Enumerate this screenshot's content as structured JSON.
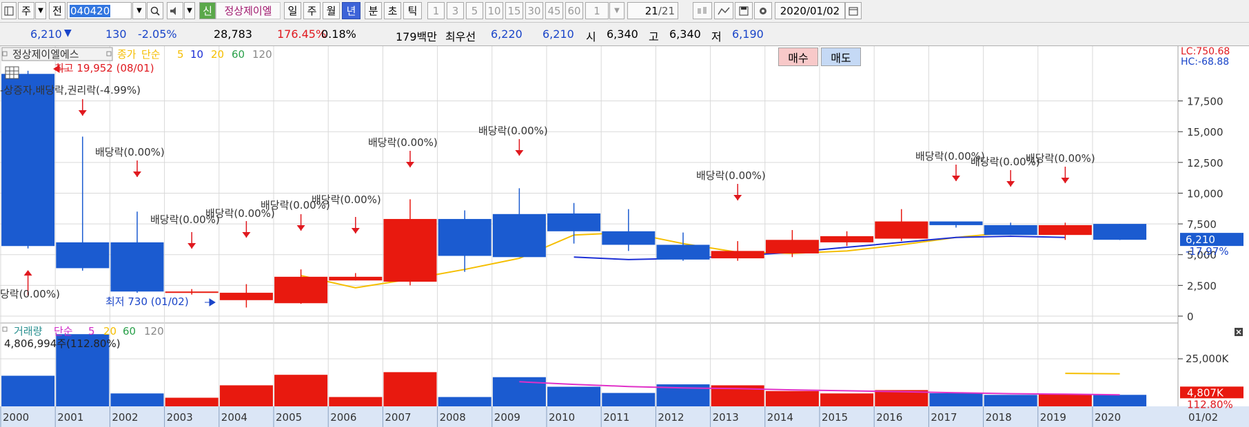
{
  "toolbar": {
    "period_select": "주",
    "prev_label": "전",
    "stock_code": "040420",
    "new_badge": "신",
    "stock_name": "정상제이엘",
    "tf_day": "일",
    "tf_week": "주",
    "tf_month": "월",
    "tf_year": "년",
    "tf_minute": "분",
    "tf_second": "초",
    "tf_tick": "틱",
    "intervals": [
      "1",
      "3",
      "5",
      "10",
      "15",
      "30",
      "45",
      "60"
    ],
    "interval_input": "1",
    "count_value": "21",
    "count_total": "/21",
    "date_value": "2020/01/02"
  },
  "quote": {
    "price": "6,210",
    "change_arrow": "▼",
    "change": "130",
    "change_pct": "-2.05%",
    "volume": "28,783",
    "volume_ratio": "176.45%",
    "turnover": "0.18%",
    "trade_value": "179백만",
    "best_label": "최우선",
    "best_ask": "6,220",
    "best_bid": "6,210",
    "open_label": "시",
    "open": "6,340",
    "high_label": "고",
    "high": "6,340",
    "low_label": "저",
    "low": "6,190",
    "buy_label": "매수",
    "sell_label": "매도"
  },
  "colors": {
    "up": "#e8190f",
    "down": "#1b5bd0",
    "ma5": "#f5be00",
    "ma10": "#1c2fd6",
    "vol_ma": "#e030c8",
    "grid": "#d9d9d9",
    "axis_bg": "#dbe6f6"
  },
  "chart_data": [
    {
      "type": "candlestick",
      "legend": {
        "title": "정상제이엘에스",
        "price_label": "종가",
        "ma_label": "단순",
        "ma_periods": [
          "5",
          "10",
          "20",
          "60",
          "120"
        ]
      },
      "x": [
        "2000",
        "2001",
        "2002",
        "2003",
        "2004",
        "2005",
        "2006",
        "2007",
        "2008",
        "2009",
        "2010",
        "2011",
        "2012",
        "2013",
        "2014",
        "2015",
        "2016",
        "2017",
        "2018",
        "2019",
        "2020"
      ],
      "open": [
        19700,
        6000,
        6000,
        1900,
        1300,
        1050,
        2900,
        2800,
        7900,
        8300,
        8350,
        6900,
        5800,
        4700,
        5100,
        6000,
        6300,
        7700,
        7400,
        6600,
        7500
      ],
      "high": [
        19952,
        14600,
        8500,
        2200,
        2600,
        3800,
        3500,
        9500,
        8600,
        10400,
        9200,
        8700,
        6800,
        6100,
        7000,
        6900,
        8700,
        7700,
        7600,
        7600,
        7500
      ],
      "low": [
        5500,
        3700,
        1900,
        1750,
        700,
        1000,
        2900,
        2500,
        3600,
        4800,
        5900,
        5300,
        4500,
        4500,
        4800,
        5700,
        6100,
        7200,
        6600,
        6200,
        6190
      ],
      "close": [
        5700,
        3900,
        2000,
        2000,
        1900,
        3200,
        3200,
        7900,
        4900,
        4800,
        6900,
        5800,
        4600,
        5300,
        6200,
        6500,
        7700,
        7400,
        6600,
        7400,
        6210
      ],
      "ma5": [
        null,
        null,
        null,
        null,
        null,
        3300,
        2300,
        3000,
        3800,
        4700,
        6600,
        6800,
        5900,
        5200,
        5100,
        5300,
        5800,
        6400,
        6800,
        null,
        5500
      ],
      "ma10": [
        null,
        null,
        null,
        null,
        null,
        null,
        null,
        null,
        null,
        null,
        4800,
        4600,
        4700,
        4900,
        5200,
        5600,
        6000,
        6400,
        6500,
        6400,
        null
      ],
      "ylim": [
        0,
        20500
      ],
      "y_ticks": [
        "0",
        "2,500",
        "5,000",
        "7,500",
        "10,000",
        "12,500",
        "15,000",
        "17,500"
      ],
      "annotations": {
        "high": "최고 19,952 (08/01)",
        "low": "최저 730 (01/02)",
        "events": [
          "-상증자,배당락,권리락(-4.99%)",
          "배당락(0.00%)",
          "배당락(0.00%)",
          "배당락(0.00%)",
          "배당락(0.00%)",
          "배당락(0.00%)",
          "배당락(0.00%)",
          "배당락(0.00%)",
          "배당락(0.00%)",
          "배당락(0.00%)",
          "배당락(0.00%)",
          "배당락(0.00%)",
          "배당락(0.00%)",
          "배당락(0.00%)",
          "당락(0.00%)"
        ]
      },
      "right_labels": {
        "lc": "LC:750.68",
        "hc": "HC:-68.88",
        "price": "6,210",
        "pct": "-17.97%"
      }
    },
    {
      "type": "bar",
      "legend": {
        "title": "거래량",
        "ma_label": "단순",
        "ma_periods": [
          "5",
          "20",
          "60",
          "120"
        ]
      },
      "x": [
        "2000",
        "2001",
        "2002",
        "2003",
        "2004",
        "2005",
        "2006",
        "2007",
        "2008",
        "2009",
        "2010",
        "2011",
        "2012",
        "2013",
        "2014",
        "2015",
        "2016",
        "2017",
        "2018",
        "2019",
        "2020"
      ],
      "values": [
        12800,
        30200,
        5400,
        3600,
        8800,
        13200,
        3900,
        14300,
        3900,
        12200,
        8200,
        5600,
        9200,
        8800,
        6400,
        5400,
        6800,
        5500,
        4800,
        4900,
        4807
      ],
      "ma5": [
        null,
        null,
        null,
        null,
        null,
        14800,
        null,
        9300,
        null,
        10300,
        9200,
        8300,
        7700,
        7400,
        6900,
        6500,
        6100,
        5700,
        5300,
        5100,
        4800
      ],
      "ma20_partial": [
        null,
        null,
        null,
        null,
        null,
        null,
        null,
        null,
        null,
        null,
        null,
        null,
        null,
        null,
        null,
        null,
        null,
        null,
        null,
        13800,
        13600
      ],
      "info": "4,806,994주(112.80%)",
      "ylim": [
        0,
        34000
      ],
      "y_ticks": [
        "25,000K"
      ],
      "right_labels": {
        "value": "4,807K",
        "pct": "112.80%"
      }
    }
  ],
  "x_axis_date": "01/02"
}
